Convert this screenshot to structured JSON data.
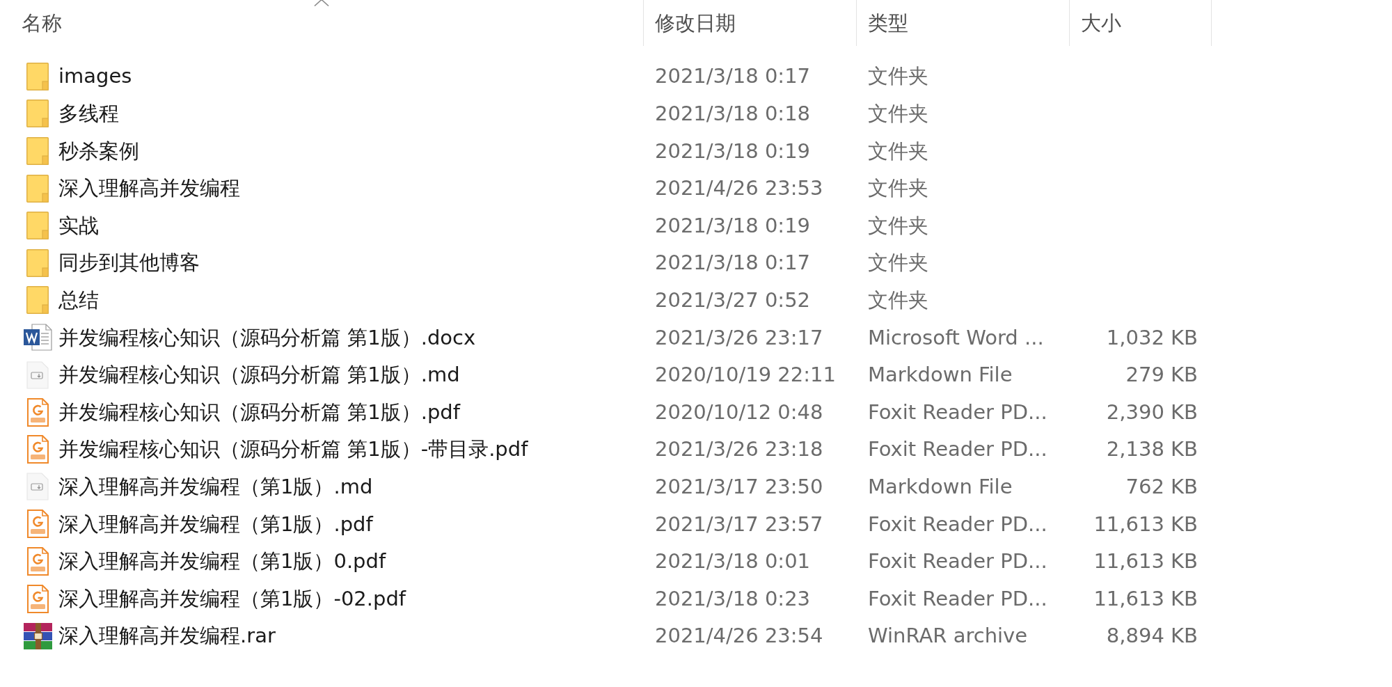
{
  "columns": [
    {
      "label": "名称",
      "sorted": true
    },
    {
      "label": "修改日期",
      "sorted": false
    },
    {
      "label": "类型",
      "sorted": false
    },
    {
      "label": "大小",
      "sorted": false
    }
  ],
  "rows": [
    {
      "kind": "folder",
      "name": "images",
      "modified": "2021/3/18 0:17",
      "type": "文件夹"
    },
    {
      "kind": "folder",
      "name": "多线程",
      "modified": "2021/3/18 0:18",
      "type": "文件夹"
    },
    {
      "kind": "folder",
      "name": "秒杀案例",
      "modified": "2021/3/18 0:19",
      "type": "文件夹"
    },
    {
      "kind": "folder",
      "name": "深入理解高并发编程",
      "modified": "2021/4/26 23:53",
      "type": "文件夹"
    },
    {
      "kind": "folder",
      "name": "实战",
      "modified": "2021/3/18 0:19",
      "type": "文件夹"
    },
    {
      "kind": "folder",
      "name": "同步到其他博客",
      "modified": "2021/3/18 0:17",
      "type": "文件夹"
    },
    {
      "kind": "folder",
      "name": "总结",
      "modified": "2021/3/27 0:52",
      "type": "文件夹"
    },
    {
      "kind": "word",
      "name": "并发编程核心知识（源码分析篇 第1版）.docx",
      "modified": "2021/3/26 23:17",
      "type": "Microsoft Word ...",
      "size": "1,032 KB"
    },
    {
      "kind": "markdown",
      "name": "并发编程核心知识（源码分析篇 第1版）.md",
      "modified": "2020/10/19 22:11",
      "type": "Markdown File",
      "size": "279 KB"
    },
    {
      "kind": "pdf",
      "name": "并发编程核心知识（源码分析篇 第1版）.pdf",
      "modified": "2020/10/12 0:48",
      "type": "Foxit Reader PD...",
      "size": "2,390 KB"
    },
    {
      "kind": "pdf",
      "name": "并发编程核心知识（源码分析篇 第1版）-带目录.pdf",
      "modified": "2021/3/26 23:18",
      "type": "Foxit Reader PD...",
      "size": "2,138 KB"
    },
    {
      "kind": "markdown",
      "name": "深入理解高并发编程（第1版）.md",
      "modified": "2021/3/17 23:50",
      "type": "Markdown File",
      "size": "762 KB"
    },
    {
      "kind": "pdf",
      "name": "深入理解高并发编程（第1版）.pdf",
      "modified": "2021/3/17 23:57",
      "type": "Foxit Reader PD...",
      "size": "11,613 KB"
    },
    {
      "kind": "pdf",
      "name": "深入理解高并发编程（第1版）0.pdf",
      "modified": "2021/3/18 0:01",
      "type": "Foxit Reader PD...",
      "size": "11,613 KB"
    },
    {
      "kind": "pdf",
      "name": "深入理解高并发编程（第1版）-02.pdf",
      "modified": "2021/3/18 0:23",
      "type": "Foxit Reader PD...",
      "size": "11,613 KB"
    },
    {
      "kind": "rar",
      "name": "深入理解高并发编程.rar",
      "modified": "2021/4/26 23:54",
      "type": "WinRAR archive",
      "size": "8,894 KB"
    }
  ]
}
